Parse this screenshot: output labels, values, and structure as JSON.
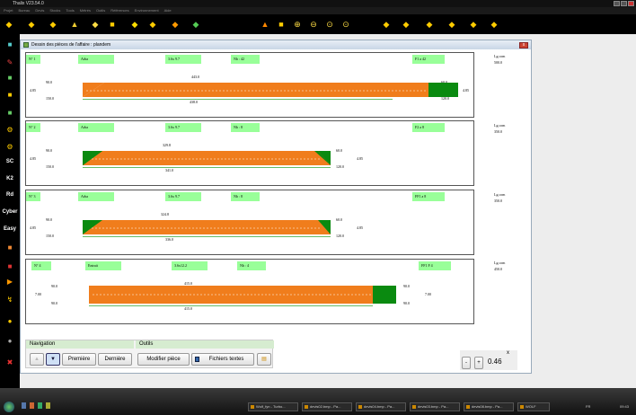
{
  "app": {
    "title": "Thalix V23.54.0"
  },
  "menu": [
    "Projet",
    "Bureau",
    "Devis",
    "Stocks",
    "Tools",
    "Métrés",
    "Outils",
    "Références",
    "Environnement",
    "Aide"
  ],
  "window": {
    "title": "Dessin des pièces de l'affaire : plandem",
    "close": "x"
  },
  "left_labels": [
    "SC",
    "K2",
    "Rd",
    "Cyber",
    "Easy"
  ],
  "pieces": [
    {
      "num": "N° 1",
      "type": "Arba",
      "section": "3.6x 9.7",
      "count": "Nb : 42",
      "ref": "F1 a 42",
      "top_len": "443.0",
      "bottom_len": "438.0",
      "left_dims": [
        "90.0",
        "4.85",
        "150.0"
      ],
      "right_dims": [
        "60.0",
        "120.0"
      ],
      "right_h": "4.85",
      "lg_label": "Lg.com",
      "lg_value": "500.0"
    },
    {
      "num": "N° 2",
      "type": "Arba",
      "section": "3.6x 9.7",
      "count": "Nb : 8",
      "ref": "F2 a 8",
      "top_len": "329.8",
      "bottom_len": "341.0",
      "left_dims": [
        "90.0",
        "4.85",
        "150.0"
      ],
      "right_dims": [
        "60.0",
        "120.0"
      ],
      "right_h": "4.85",
      "lg_label": "Lg.com",
      "lg_value": "350.0"
    },
    {
      "num": "N° 3",
      "type": "Arba",
      "section": "3.6x 9.7",
      "count": "Nb : 8",
      "ref": "FF1 a 8",
      "top_len": "324.8",
      "bottom_len": "336.0",
      "left_dims": [
        "90.0",
        "4.85",
        "150.0"
      ],
      "right_dims": [
        "60.0",
        "120.0"
      ],
      "right_h": "4.85",
      "lg_label": "Lg.com",
      "lg_value": "350.0"
    },
    {
      "num": "N° 4",
      "type": "Entrait",
      "section": "3.6x12.2",
      "count": "Nb : 4",
      "ref": "FF1 F 4",
      "top_len": "415.0",
      "bottom_len": "415.0",
      "left_dims": [
        "90.0",
        "7.00",
        "90.0"
      ],
      "right_dims": [
        "90.0",
        "90.0"
      ],
      "right_h": "7.00",
      "lg_label": "Lg.com",
      "lg_value": "450.0"
    }
  ],
  "nav": {
    "navigation_label": "Navigation",
    "outils_label": "Outils",
    "first": "Première",
    "last": "Dernière",
    "modify": "Modifier pièce",
    "files": "Fichiers textes"
  },
  "zoom": {
    "minus": "-",
    "plus": "+",
    "value": "0.46",
    "close": "x"
  },
  "taskbar": [
    "Wolf_fyn - Turbo...",
    "devis02.bmp - Pa...",
    "devis04.bmp - Pa...",
    "devis03.bmp - Pa...",
    "devis08.bmp - Pa...",
    "WOLF"
  ],
  "clock": "09:43",
  "lang": "FR"
}
